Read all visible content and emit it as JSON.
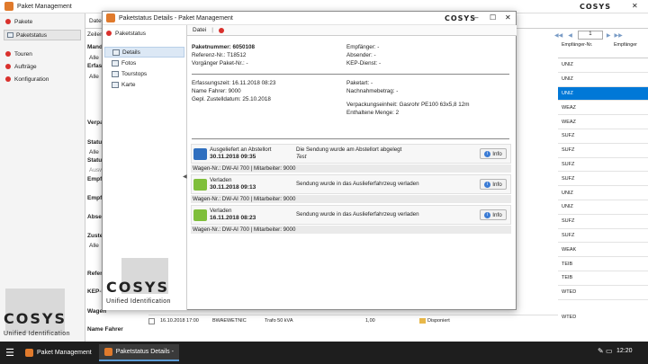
{
  "main_window": {
    "title": "Paket Management",
    "logo": "COSYS",
    "sidebar": {
      "items": [
        {
          "label": "Pakete",
          "icon": "package-icon",
          "color": "#d9302c"
        },
        {
          "label": "Paketstatus",
          "icon": "status-icon",
          "sub": true
        },
        {
          "label": "Touren",
          "icon": "tours-icon",
          "color": "#d9302c"
        },
        {
          "label": "Aufträge",
          "icon": "orders-icon",
          "color": "#d9302c"
        },
        {
          "label": "Konfiguration",
          "icon": "config-icon",
          "color": "#d9302c"
        }
      ]
    },
    "background_fragments": {
      "tab": "Date",
      "zeilen": "Zeilen",
      "mand": "Mand",
      "alle1": "Alle",
      "erfas": "Erfas",
      "alle2": "Alle",
      "verpa": "Verpa",
      "status": "Status",
      "alle3": "Alle",
      "status2": "Status",
      "ausw": "Auswa",
      "empf": "Empfa",
      "empf2": "Empf",
      "absen": "Absen",
      "zuste": "Zuste",
      "alle4": "Alle",
      "refer": "Refer",
      "kep": "KEP-D",
      "wagen": "Wagen",
      "name_fahrer": "Name Fahrer"
    },
    "paging": {
      "page": "1"
    },
    "grid_headers": [
      "Empfänger-Nr.",
      "Empfänger"
    ],
    "grid_col_values": [
      "UNIZ",
      "UNIZ",
      "UNIZ",
      "WEAZ",
      "WEAZ",
      "SUFZ",
      "SUFZ",
      "SUFZ",
      "SUFZ",
      "UNIZ",
      "UNIZ",
      "SUFZ",
      "SUFZ",
      "WEAK",
      "TEIB",
      "TEIB",
      "WTED"
    ],
    "selected_row_index": 2,
    "bottom_row": {
      "date": "16.10.2018 17:00",
      "code": "BWAEWETNIC",
      "desc": "Trafo 50 kVA",
      "qty": "1,00",
      "status": "Disponiert",
      "nr": "WTED"
    }
  },
  "modal": {
    "title": "Paketstatus Details - Paket Management",
    "logo": "COSYS",
    "nav_header": "Paketstatus",
    "nav_items": [
      {
        "label": "Details",
        "icon": "details-icon",
        "selected": true
      },
      {
        "label": "Fotos",
        "icon": "photos-icon"
      },
      {
        "label": "Tourstops",
        "icon": "tourstops-icon"
      },
      {
        "label": "Karte",
        "icon": "map-icon"
      }
    ],
    "toolbar": {
      "file": "Datei",
      "sep": "|"
    },
    "brand_text": "Unified Identification",
    "info": {
      "paketnummer": "Paketnummer: 6050108",
      "referenz": "Referenz-Nr.: T18512",
      "vorgaenger": "Vorgänger Paket-Nr.: -",
      "empfaenger": "Empfänger: -",
      "absender": "Absender: -",
      "kep": "KEP-Dienst: -",
      "erfassungszeit": "Erfassungszeit: 16.11.2018 08:23",
      "fahrer": "Name Fahrer: 9000",
      "zustelldatum": "Gepl. Zustelldatum: 25.10.2018",
      "paketart": "Paketart: -",
      "nachnahme": "Nachnahmebetrag: -",
      "verpackung": "Verpackungseinheit: Gasrohr PE100 63x5,8 12m",
      "menge": "Enthaltene Menge: 2"
    },
    "events": [
      {
        "status": "Ausgeliefert an Abstellort",
        "date": "30.11.2018 09:35",
        "message": "Die Sendung wurde am Abstellort abgelegt",
        "note": "Test",
        "sub": "Wagen-Nr.: DW-AI 700 | Mitarbeiter: 9000",
        "button": "Info",
        "icon": "delivered-icon",
        "color": "#2f6fbf"
      },
      {
        "status": "Verladen",
        "date": "30.11.2018 09:13",
        "message": "Sendung wurde in das Auslieferfahrzeug verladen",
        "note": "",
        "sub": "Wagen-Nr.: DW-AI 700 | Mitarbeiter: 9000",
        "button": "Info",
        "icon": "loaded-icon",
        "color": "#7fbf3a"
      },
      {
        "status": "Verladen",
        "date": "16.11.2018 08:23",
        "message": "Sendung wurde in das Auslieferfahrzeug verladen",
        "note": "",
        "sub": "Wagen-Nr.: DW-AI 700 | Mitarbeiter: 9000",
        "button": "Info",
        "icon": "loaded-icon",
        "color": "#7fbf3a"
      }
    ]
  },
  "taskbar": {
    "tasks": [
      {
        "label": "Paket Management",
        "active": false
      },
      {
        "label": "Paketstatus Details -",
        "active": true
      }
    ],
    "clock": "12:20"
  },
  "brand_text": "Unified Identification",
  "logo": "COSYS"
}
